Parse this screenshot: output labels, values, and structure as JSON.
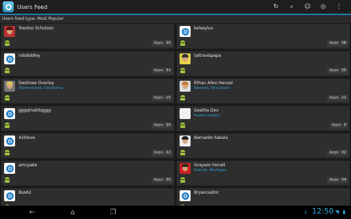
{
  "app": {
    "title": "Users Feed"
  },
  "actions": [
    "sync-icon",
    "search-icon",
    "profile-icon",
    "cloud-icon",
    "overflow-icon"
  ],
  "subheader": "Users feed type: Most Popular",
  "apps_label": "Apps",
  "users": [
    {
      "name": "Trenton Scholzen",
      "location": "",
      "apps": "20",
      "avatar": "photo",
      "hair": "#5a1010",
      "bg": "#b33"
    },
    {
      "name": "kelseyluv",
      "location": "",
      "apps": "38",
      "avatar": "default"
    },
    {
      "name": "robdiddley",
      "location": "",
      "apps": "31",
      "avatar": "default"
    },
    {
      "name": "taitravispapa",
      "location": "",
      "apps": "35",
      "avatar": "photo",
      "hair": "#333",
      "bg": "#e8d24a"
    },
    {
      "name": "Destinee Overley",
      "location": "Wynnewood, Oklahoma",
      "apps": "15",
      "avatar": "photo",
      "hair": "#e0c060",
      "bg": "#777"
    },
    {
      "name": "Ethan Allen Hensel",
      "location": "Needah, Wisconsin",
      "apps": "21",
      "avatar": "photo",
      "hair": "#c47a3c",
      "bg": "#ddd"
    },
    {
      "name": "gggqmatttqggg",
      "location": "",
      "apps": "30",
      "avatar": "default"
    },
    {
      "name": "Geetha Dev",
      "location": "Kuala Lumpur",
      "apps": "0",
      "avatar": "blank"
    },
    {
      "name": "420love",
      "location": "",
      "apps": "22",
      "avatar": "default"
    },
    {
      "name": "Bernardo Sakala",
      "location": "",
      "apps": "32",
      "avatar": "photo",
      "hair": "#222",
      "bg": "#eee"
    },
    {
      "name": "amcpake",
      "location": "",
      "apps": "30",
      "avatar": "default"
    },
    {
      "name": "Grayson Ferrell",
      "location": "Detroit, Michigan",
      "apps": "34",
      "avatar": "photo",
      "hair": "#3a2a1a",
      "bg": "#c22"
    },
    {
      "name": "Bus62",
      "location": "",
      "apps": "",
      "avatar": "default"
    },
    {
      "name": "Bryancastor",
      "location": "",
      "apps": "",
      "avatar": "default"
    }
  ],
  "nav": {
    "back": "back-icon",
    "home": "home-icon",
    "recents": "recent-apps-icon"
  },
  "status": {
    "time": "12:50"
  },
  "colors": {
    "accent": "#1e7fb0",
    "location": "#2ea3d6",
    "android": "#9fc33b"
  }
}
